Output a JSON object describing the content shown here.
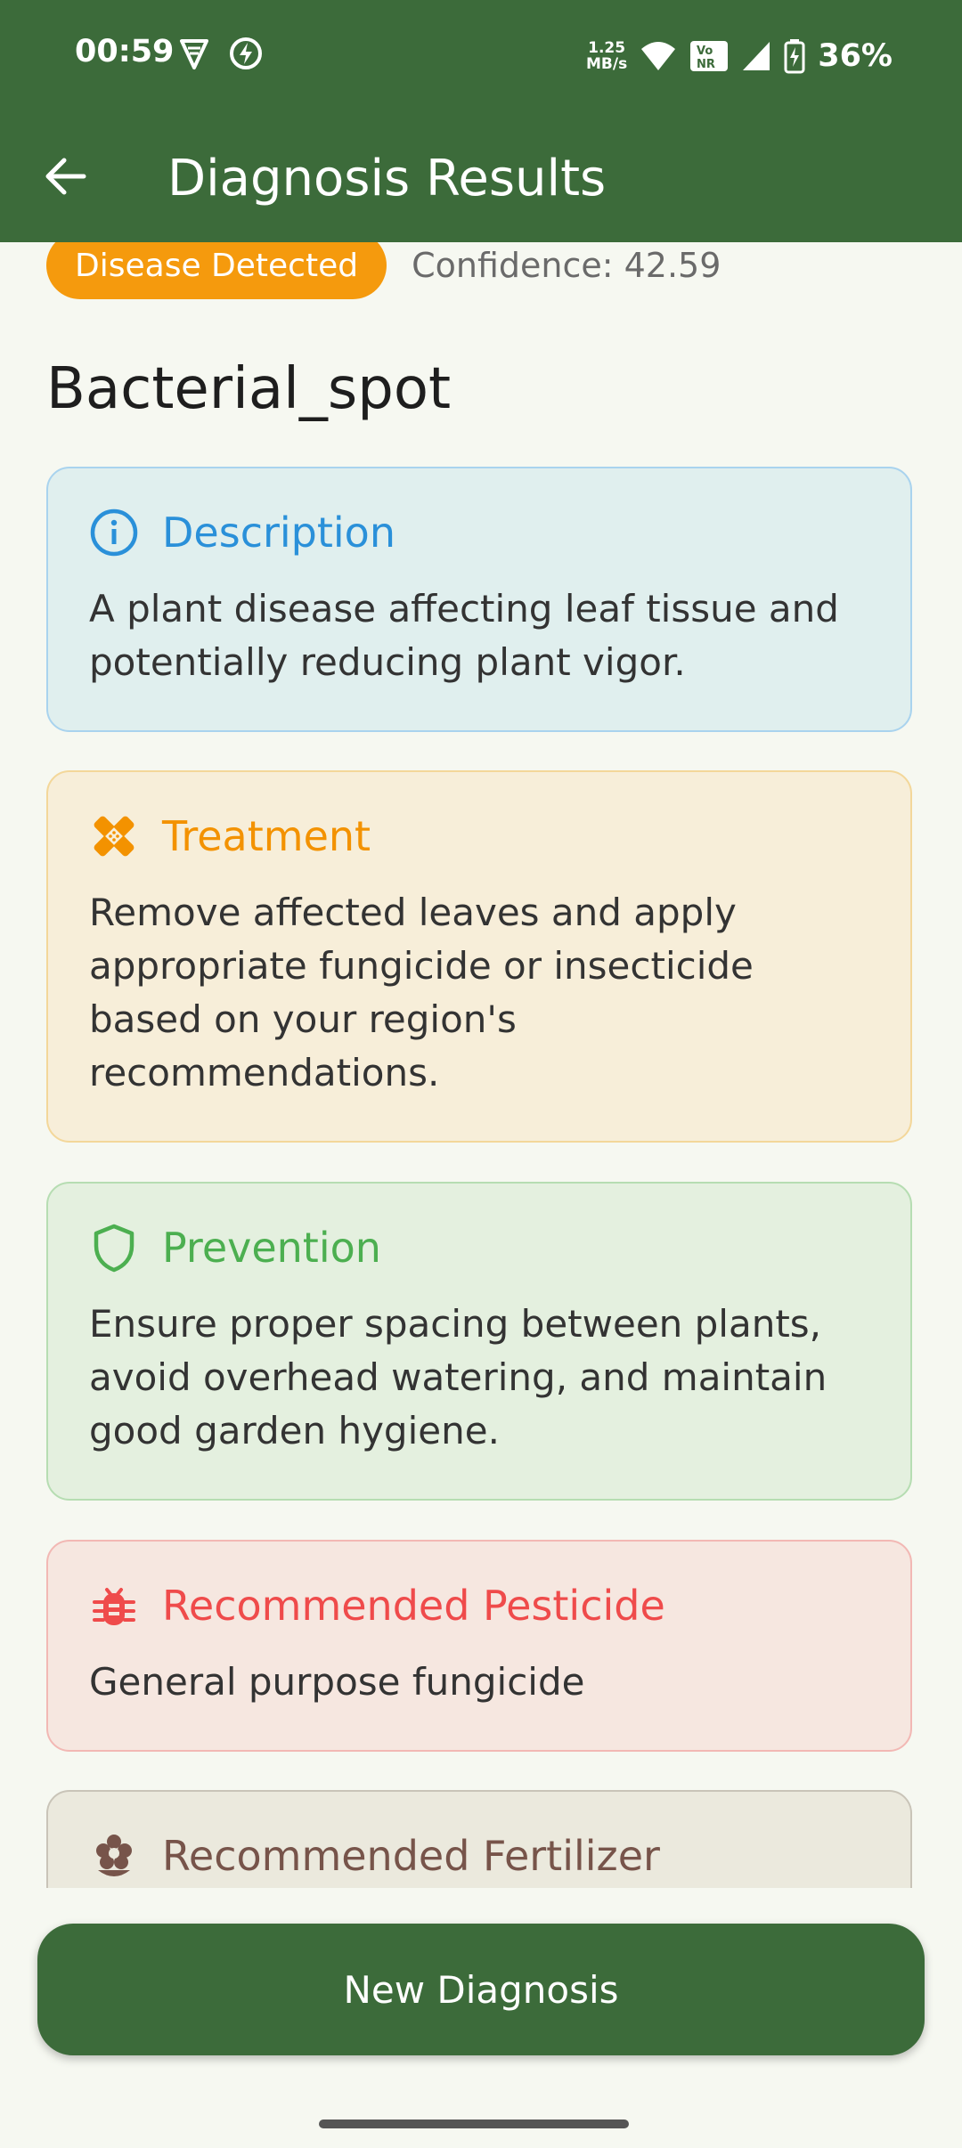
{
  "status_bar": {
    "time": "00:59",
    "net_speed_value": "1.25",
    "net_speed_unit": "MB/s",
    "volte_label_top": "Vo",
    "volte_label_bottom": "NR",
    "battery": "36%",
    "icons": [
      "vpn-icon",
      "bolt-icon",
      "wifi-icon",
      "volte-icon",
      "signal-icon",
      "battery-charging-icon"
    ]
  },
  "header": {
    "title": "Diagnosis Results",
    "background": "#3C6B3A"
  },
  "result": {
    "badge": "Disease Detected",
    "badge_color": "#F59A0D",
    "confidence": "Confidence: 42.59",
    "disease_name": "Bacterial_spot"
  },
  "cards": {
    "description": {
      "title": "Description",
      "text": "A plant disease affecting leaf tissue and potentially reducing plant vigor.",
      "icon": "info-icon",
      "color": "#2A90D9"
    },
    "treatment": {
      "title": "Treatment",
      "text": "Remove affected leaves and apply appropriate fungicide or insecticide based on your region's recommendations.",
      "icon": "bandage-icon",
      "color": "#F39200"
    },
    "prevention": {
      "title": "Prevention",
      "text": "Ensure proper spacing between plants, avoid overhead watering, and maintain good garden hygiene.",
      "icon": "shield-icon",
      "color": "#4CAF50"
    },
    "pesticide": {
      "title": "Recommended Pesticide",
      "text": "General purpose fungicide",
      "icon": "bug-icon",
      "color": "#EF4B4B"
    },
    "fertilizer": {
      "title": "Recommended Fertilizer",
      "icon": "flower-icon",
      "color": "#77544A"
    }
  },
  "actions": {
    "new_diagnosis": "New Diagnosis"
  }
}
